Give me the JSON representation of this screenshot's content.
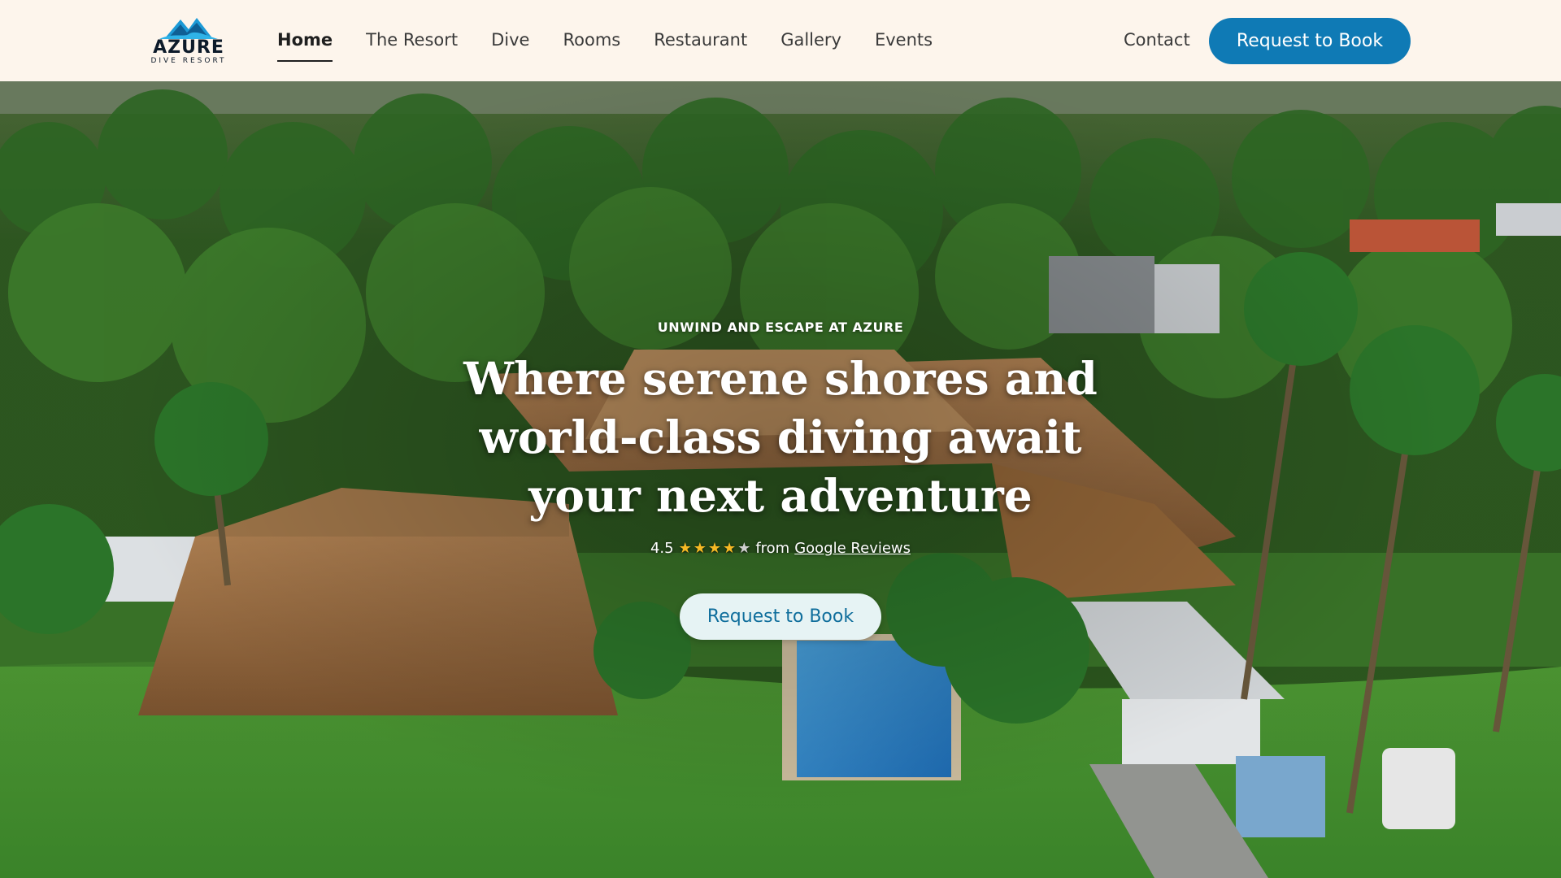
{
  "brand": {
    "name": "AZURE",
    "tagline": "DIVE RESORT",
    "logo_icon": "mountain-wave-logo-icon",
    "colors": {
      "primary": "#0f7ab5",
      "header_bg": "#fdf5ec",
      "secondary_button_bg": "#e6f3f4",
      "star": "#f7b924"
    }
  },
  "nav": {
    "items": [
      {
        "label": "Home",
        "active": true
      },
      {
        "label": "The Resort",
        "active": false
      },
      {
        "label": "Dive",
        "active": false
      },
      {
        "label": "Rooms",
        "active": false
      },
      {
        "label": "Restaurant",
        "active": false
      },
      {
        "label": "Gallery",
        "active": false
      },
      {
        "label": "Events",
        "active": false
      }
    ],
    "contact": "Contact",
    "cta": "Request to Book"
  },
  "hero": {
    "eyebrow": "UNWIND AND ESCAPE AT AZURE",
    "headline_lines": [
      "Where serene shores and",
      "world-class diving await",
      "your next adventure"
    ],
    "rating": {
      "score": "4.5",
      "stars": 4.5,
      "from_text": "from",
      "source_link": "Google Reviews"
    },
    "cta": "Request to Book",
    "background": "aerial-photo-resort-thatched-roofs-pool-jungle"
  }
}
